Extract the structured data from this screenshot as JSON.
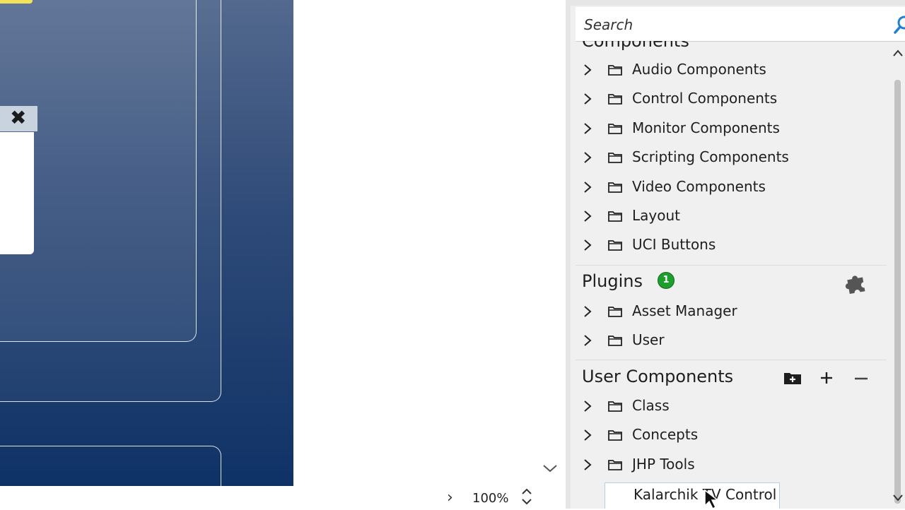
{
  "search": {
    "placeholder": "Search"
  },
  "components": {
    "header": "Components",
    "items": [
      {
        "label": "Audio Components"
      },
      {
        "label": "Control Components"
      },
      {
        "label": "Monitor Components"
      },
      {
        "label": "Scripting Components"
      },
      {
        "label": "Video Components"
      },
      {
        "label": "Layout"
      },
      {
        "label": "UCI Buttons"
      }
    ]
  },
  "plugins": {
    "header": "Plugins",
    "badge": "1",
    "items": [
      {
        "label": "Asset Manager"
      },
      {
        "label": "User"
      }
    ]
  },
  "user_components": {
    "header": "User Components",
    "items": [
      {
        "label": "Class"
      },
      {
        "label": "Concepts"
      },
      {
        "label": "JHP Tools"
      }
    ],
    "selected_item": "Kalarchik TV Control"
  },
  "canvas": {
    "zoom": "100%",
    "dialog_close": "✖"
  },
  "colors": {
    "badge_green": "#1e9e2d",
    "uci_background": "#0f3266",
    "selection_border": "#b8cde3"
  }
}
